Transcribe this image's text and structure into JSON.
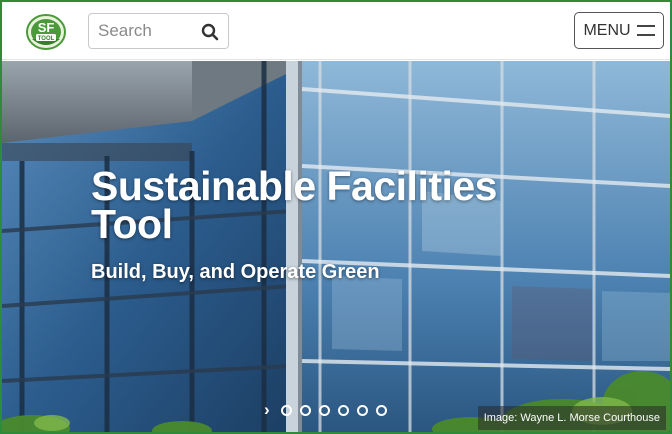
{
  "header": {
    "logo_text": "SF TOOL",
    "search": {
      "placeholder": "Search",
      "value": ""
    },
    "menu_label": "MENU"
  },
  "hero": {
    "title": "Sustainable Facilities Tool",
    "subtitle": "Build, Buy, and Operate Green",
    "carousel": {
      "next_glyph": "›",
      "dots_count": 6
    },
    "image_credit": "Image: Wayne L. Morse Courthouse"
  },
  "colors": {
    "frame_border": "#2f8a3a",
    "logo_green": "#4a9a3a",
    "hero_glass": "#3f77a8"
  },
  "icons": [
    "sf-tool-logo-icon",
    "search-icon",
    "hamburger-menu-icon",
    "chevron-right-icon"
  ]
}
